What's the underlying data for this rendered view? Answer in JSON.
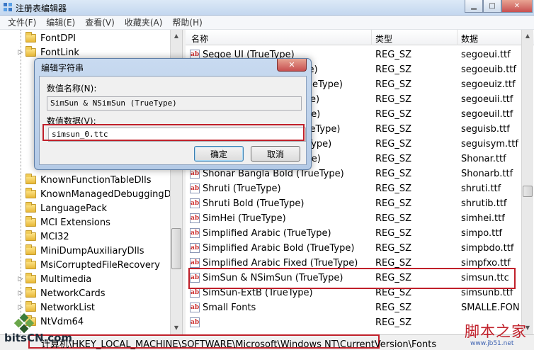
{
  "window": {
    "title": "注册表编辑器"
  },
  "menu": [
    "文件(F)",
    "编辑(E)",
    "查看(V)",
    "收藏夹(A)",
    "帮助(H)"
  ],
  "tree": {
    "items": [
      {
        "label": "FontDPI",
        "expandable": false
      },
      {
        "label": "FontLink",
        "expandable": true
      },
      {
        "label": "KnownFunctionTableDlls",
        "expandable": false
      },
      {
        "label": "KnownManagedDebuggingDlls",
        "expandable": false
      },
      {
        "label": "LanguagePack",
        "expandable": false
      },
      {
        "label": "MCI Extensions",
        "expandable": false
      },
      {
        "label": "MCI32",
        "expandable": false
      },
      {
        "label": "MiniDumpAuxiliaryDlls",
        "expandable": false
      },
      {
        "label": "MsiCorruptedFileRecovery",
        "expandable": false
      },
      {
        "label": "Multimedia",
        "expandable": true
      },
      {
        "label": "NetworkCards",
        "expandable": true
      },
      {
        "label": "NetworkList",
        "expandable": true
      },
      {
        "label": "NtVdm64",
        "expandable": false
      }
    ]
  },
  "list": {
    "headers": {
      "name": "名称",
      "type": "类型",
      "data": "数据"
    },
    "rows": [
      {
        "name": "Segoe UI (TrueType)",
        "type": "REG_SZ",
        "data": "segoeui.ttf"
      },
      {
        "name": "Segoe UI Bold (TrueType)",
        "type": "REG_SZ",
        "data": "segoeuib.ttf"
      },
      {
        "name": "Segoe UI Bold Italic (TrueType)",
        "type": "REG_SZ",
        "data": "segoeuiz.ttf"
      },
      {
        "name": "Segoe UI Italic (TrueType)",
        "type": "REG_SZ",
        "data": "segoeuii.ttf"
      },
      {
        "name": "Segoe UI Light (TrueType)",
        "type": "REG_SZ",
        "data": "segoeuil.ttf"
      },
      {
        "name": "Segoe UI Semibold (TrueType)",
        "type": "REG_SZ",
        "data": "seguisb.ttf"
      },
      {
        "name": "Segoe UI Symbol (TrueType)",
        "type": "REG_SZ",
        "data": "seguisym.ttf"
      },
      {
        "name": "Shonar Bangla (TrueType)",
        "type": "REG_SZ",
        "data": "Shonar.ttf"
      },
      {
        "name": "Shonar Bangla Bold (TrueType)",
        "type": "REG_SZ",
        "data": "Shonarb.ttf"
      },
      {
        "name": "Shruti (TrueType)",
        "type": "REG_SZ",
        "data": "shruti.ttf"
      },
      {
        "name": "Shruti Bold (TrueType)",
        "type": "REG_SZ",
        "data": "shrutib.ttf"
      },
      {
        "name": "SimHei (TrueType)",
        "type": "REG_SZ",
        "data": "simhei.ttf"
      },
      {
        "name": "Simplified Arabic (TrueType)",
        "type": "REG_SZ",
        "data": "simpo.ttf"
      },
      {
        "name": "Simplified Arabic Bold (TrueType)",
        "type": "REG_SZ",
        "data": "simpbdo.ttf"
      },
      {
        "name": "Simplified Arabic Fixed (TrueType)",
        "type": "REG_SZ",
        "data": "simpfxo.ttf"
      },
      {
        "name": "SimSun & NSimSun (TrueType)",
        "type": "REG_SZ",
        "data": "simsun.ttc"
      },
      {
        "name": "SimSun-ExtB (TrueType)",
        "type": "REG_SZ",
        "data": "simsunb.ttf"
      },
      {
        "name": "Small Fonts",
        "type": "REG_SZ",
        "data": "SMALLE.FON"
      },
      {
        "name": "",
        "type": "REG_SZ",
        "data": ""
      }
    ]
  },
  "status": {
    "path": "计算机\\HKEY_LOCAL_MACHINE\\SOFTWARE\\Microsoft\\Windows NT\\CurrentVersion\\Fonts"
  },
  "dialog": {
    "title": "编辑字符串",
    "name_label": "数值名称(N):",
    "name_value": "SimSun & NSimSun (TrueType)",
    "data_label": "数值数据(V):",
    "data_value": "simsun_0.ttc",
    "ok_label": "确定",
    "cancel_label": "取消",
    "close_label": "✕"
  },
  "watermarks": {
    "left": "bitsCN.com",
    "right": "脚本之家",
    "right_sub": "www.jb51.net"
  },
  "colors": {
    "highlight_border": "#c0202a",
    "titlebar": "#c3d7ef"
  }
}
